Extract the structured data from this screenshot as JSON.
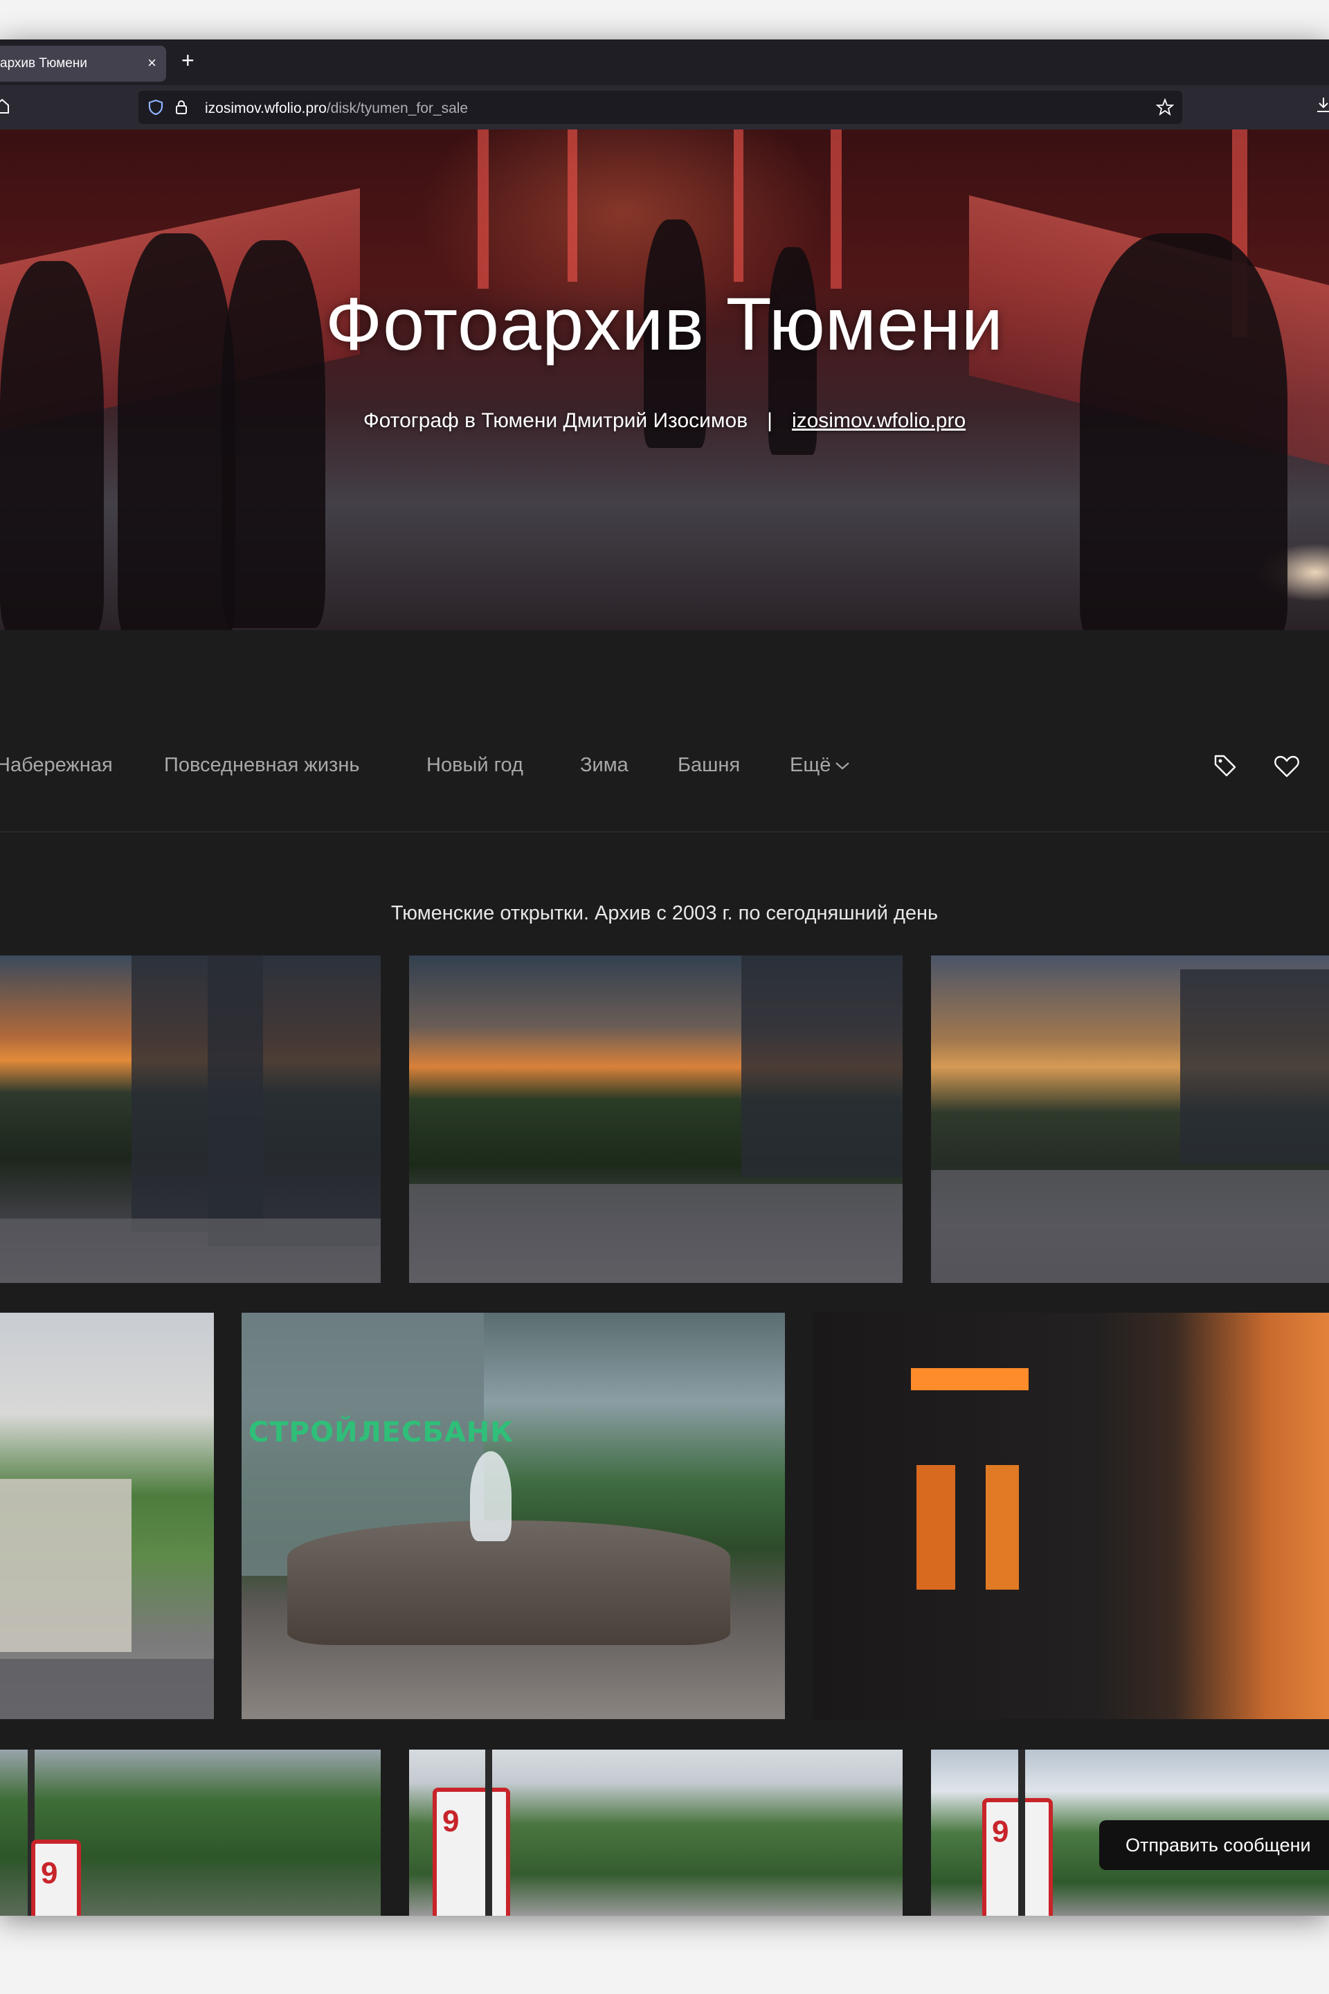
{
  "browser": {
    "tab_title": "архив Тюмени",
    "tab_close": "×",
    "new_tab": "+",
    "url_host": "izosimov.wfolio.pro",
    "url_path": "/disk/tyumen_for_sale"
  },
  "hero": {
    "title": "Фотоархив Тюмени",
    "subtitle": "Фотограф в Тюмени Дмитрий Изосимов",
    "separator": "|",
    "site_link": "izosimov.wfolio.pro"
  },
  "nav": {
    "items": [
      {
        "label": "Набережная"
      },
      {
        "label": "Повседневная жизнь"
      },
      {
        "label": "Новый год"
      },
      {
        "label": "Зима"
      },
      {
        "label": "Башня"
      }
    ],
    "more_label": "Ещё",
    "icons": [
      "tag-icon",
      "heart-icon"
    ]
  },
  "gallery": {
    "description": "Тюменские открытки. Архив с 2003 г. по сегодняшний день",
    "bank_sign": "СТРОЙЛЕСБАНК",
    "banner_text": "9"
  },
  "chat": {
    "send_message": "Отправить сообщени"
  },
  "colors": {
    "page_bg": "#1c1c1d",
    "nav_text": "#a8a8a8",
    "tab_active": "#42414d",
    "urlbar_bg": "#1c1b22"
  }
}
